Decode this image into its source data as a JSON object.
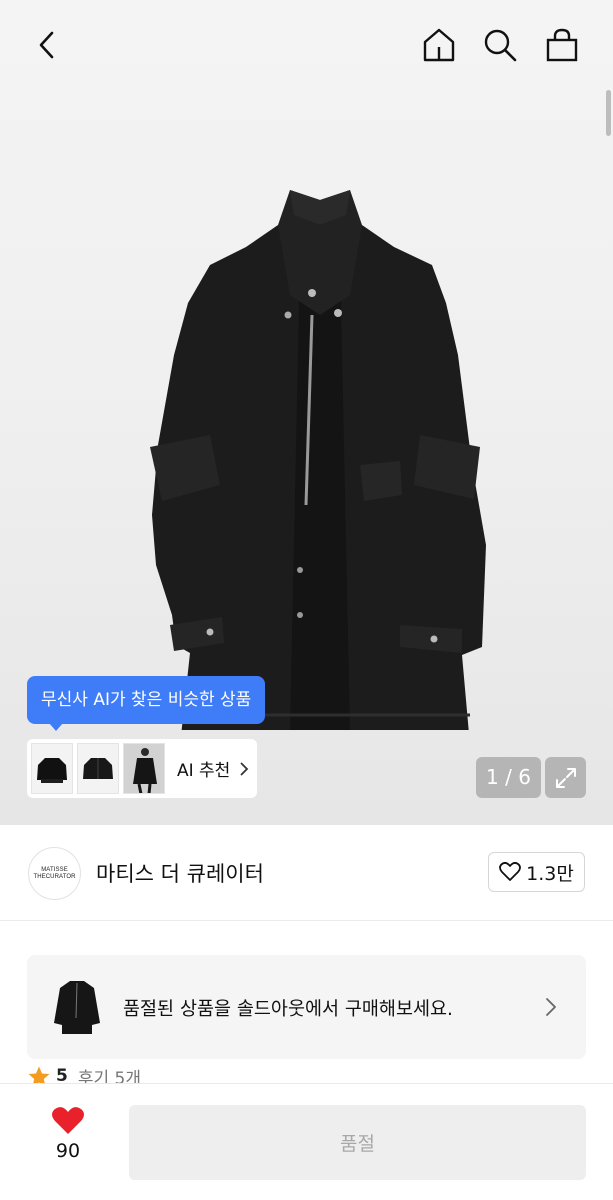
{
  "page": {
    "title": "product-detail"
  },
  "gallery": {
    "current": 1,
    "total": 6,
    "pager_text": "1 / 6"
  },
  "ai": {
    "tooltip": "무신사 AI가 찾은 비슷한 상품",
    "reco_label": "AI 추천"
  },
  "brand": {
    "logo_line1": "MATISSE",
    "logo_line2": "THECURATOR",
    "name": "마티스 더 큐레이터",
    "likes": "1.3만"
  },
  "soldout": {
    "message": "품절된 상품을 솔드아웃에서 구매해보세요."
  },
  "rating": {
    "score": "5",
    "reviews": "후기 5개"
  },
  "bottom": {
    "fav_count": "90",
    "buy_label": "품절"
  },
  "colors": {
    "accent_blue": "#3f7cf7",
    "heart_red": "#e8212b",
    "star_orange": "#f39c21",
    "disabled_bg": "#eeeeee",
    "disabled_text": "#a8a8a8"
  },
  "icons": [
    "back-icon",
    "home-icon",
    "search-icon",
    "shopping-bag-icon",
    "expand-icon",
    "heart-outline-icon",
    "heart-filled-icon",
    "star-icon",
    "chevron-right-icon"
  ]
}
